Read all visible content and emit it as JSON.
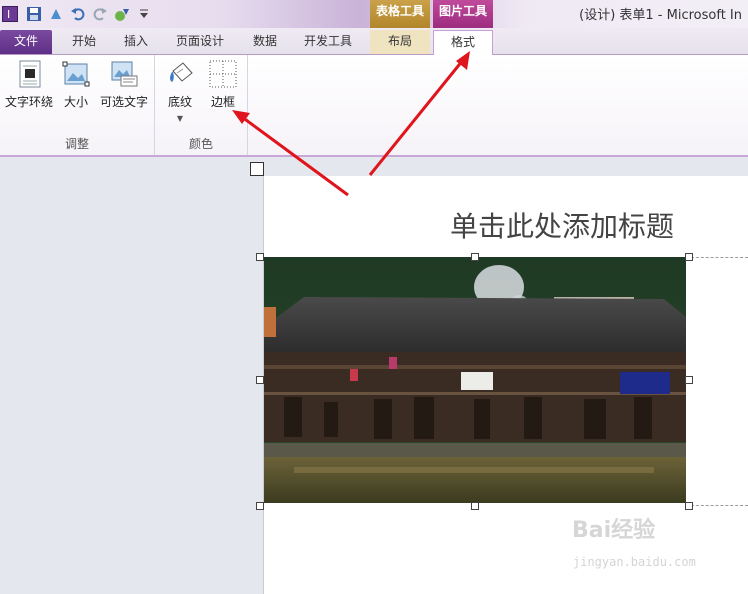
{
  "titlebar": {
    "context_table": "表格工具",
    "context_picture": "图片工具",
    "window_title": "(设计) 表单1 - Microsoft In"
  },
  "tabs": {
    "file": "文件",
    "home": "开始",
    "insert": "插入",
    "page_design": "页面设计",
    "data": "数据",
    "developer": "开发工具",
    "layout": "布局",
    "format": "格式"
  },
  "ribbon": {
    "adjust": {
      "label": "调整",
      "wrap_text": "文字环绕",
      "size": "大小",
      "alt_text": "可选文字"
    },
    "color": {
      "label": "颜色",
      "shading": "底纹",
      "border": "边框"
    }
  },
  "document": {
    "title_placeholder": "单击此处添加标题"
  },
  "watermark": {
    "brand": "Bai经验",
    "url": "jingyan.baidu.com"
  },
  "colors": {
    "file_tab": "#5e2f86",
    "context_table": "#b2862a",
    "context_picture": "#9d2c7f",
    "annotation_arrow": "#e0141c"
  }
}
